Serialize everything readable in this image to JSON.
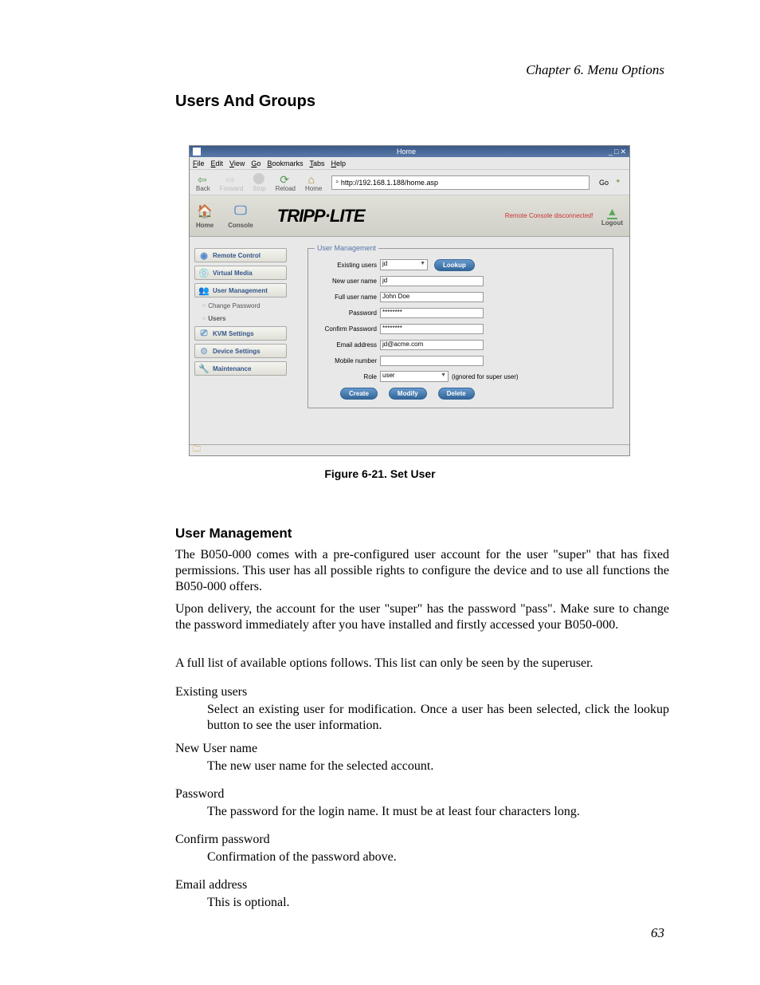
{
  "chapter_header": "Chapter 6. Menu Options",
  "section_title": "Users And Groups",
  "figure_caption": "Figure 6-21. Set User",
  "subsection_title": "User Management",
  "paragraphs": {
    "p1": "The B050-000 comes with a pre-configured user account for the user \"super\" that has fixed permissions. This user has all possible rights to configure the device and to use all functions the B050-000 offers.",
    "p2": "Upon delivery, the account for the user \"super\" has the password \"pass\". Make sure to change the password immediately after you have installed and firstly accessed your B050-000.",
    "p3": "A full list of available options follows. This list can only be seen by the superuser."
  },
  "definitions": {
    "dt1": "Existing users",
    "dd1": "Select an existing user for modification. Once a user has been selected, click the lookup button to see the user information.",
    "dt2": "New User name",
    "dd2": "The new user name for the selected account.",
    "dt3": "Password",
    "dd3": "The password for the login name. It must be at least four characters long.",
    "dt4": "Confirm password",
    "dd4": "Confirmation of the password above.",
    "dt5": "Email address",
    "dd5": "This is optional."
  },
  "page_number": "63",
  "screenshot": {
    "title": "Home",
    "window_controls": {
      "min": "_",
      "max": "□",
      "close": "✕"
    },
    "menu": {
      "file": "File",
      "edit": "Edit",
      "view": "View",
      "go": "Go",
      "bookmarks": "Bookmarks",
      "tabs": "Tabs",
      "help": "Help"
    },
    "toolbar": {
      "back": "Back",
      "forward": "Forward",
      "stop": "Stop",
      "reload": "Reload",
      "home": "Home",
      "url": "http://192.168.1.188/home.asp",
      "go": "Go"
    },
    "brand": {
      "home": "Home",
      "console": "Console",
      "logo": "TRIPP·LITE",
      "status": "Remote Console disconnected!",
      "logout": "Logout"
    },
    "sidebar": {
      "remote_control": "Remote Control",
      "virtual_media": "Virtual Media",
      "user_management": "User Management",
      "change_password": "Change Password",
      "users": "Users",
      "kvm_settings": "KVM Settings",
      "device_settings": "Device Settings",
      "maintenance": "Maintenance"
    },
    "form": {
      "legend": "User Management",
      "existing_users_label": "Existing users",
      "existing_users_value": "jd",
      "lookup": "Lookup",
      "new_user_label": "New user name",
      "new_user_value": "jd",
      "full_name_label": "Full user name",
      "full_name_value": "John Doe",
      "password_label": "Password",
      "password_value": "********",
      "confirm_label": "Confirm Password",
      "confirm_value": "********",
      "email_label": "Email address",
      "email_value": "jd@acme.com",
      "mobile_label": "Mobile number",
      "mobile_value": "",
      "role_label": "Role",
      "role_value": "user",
      "role_note": "(ignored for super user)",
      "create": "Create",
      "modify": "Modify",
      "delete": "Delete"
    }
  }
}
